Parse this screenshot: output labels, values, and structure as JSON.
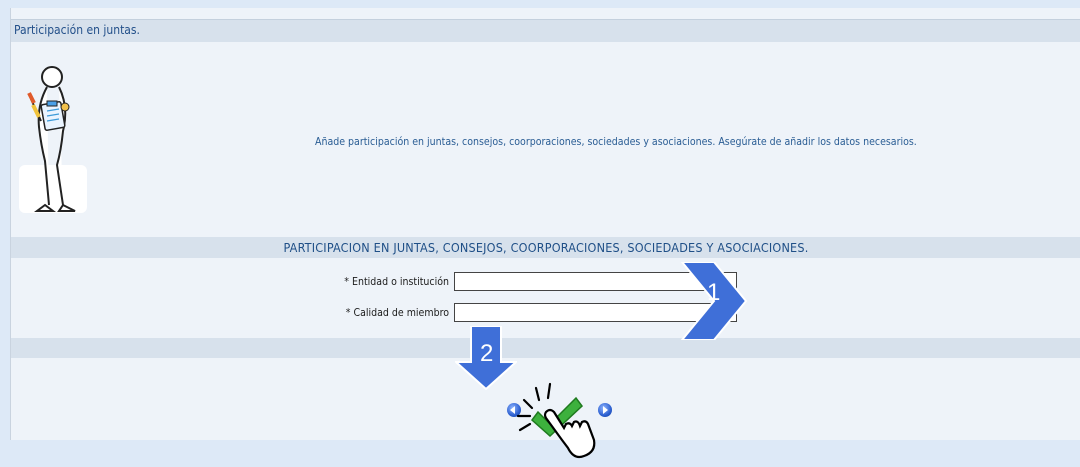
{
  "section": {
    "title": "Participación en juntas.",
    "info_text": "Añade participación en juntas, consejos, coorporaciones, sociedades y asociaciones. Asegúrate de añadir los datos necesarios."
  },
  "form": {
    "title": "PARTICIPACION EN JUNTAS, CONSEJOS, COORPORACIONES, SOCIEDADES Y ASOCIACIONES.",
    "fields": [
      {
        "label": "* Entidad o institución",
        "value": ""
      },
      {
        "label": "* Calidad de miembro",
        "value": ""
      }
    ]
  },
  "annotations": {
    "step1": "1",
    "step2": "2"
  },
  "colors": {
    "background": "#dde9f7",
    "bar": "#d7e1ec",
    "title_text": "#23508a",
    "callout_arrow": "#3f6fd8",
    "save_check": "#3db13d"
  },
  "icons": [
    "person-clipboard-icon",
    "previous-icon",
    "save-check-icon",
    "next-icon",
    "click-hand-icon",
    "arrow-right-icon",
    "arrow-down-icon"
  ]
}
